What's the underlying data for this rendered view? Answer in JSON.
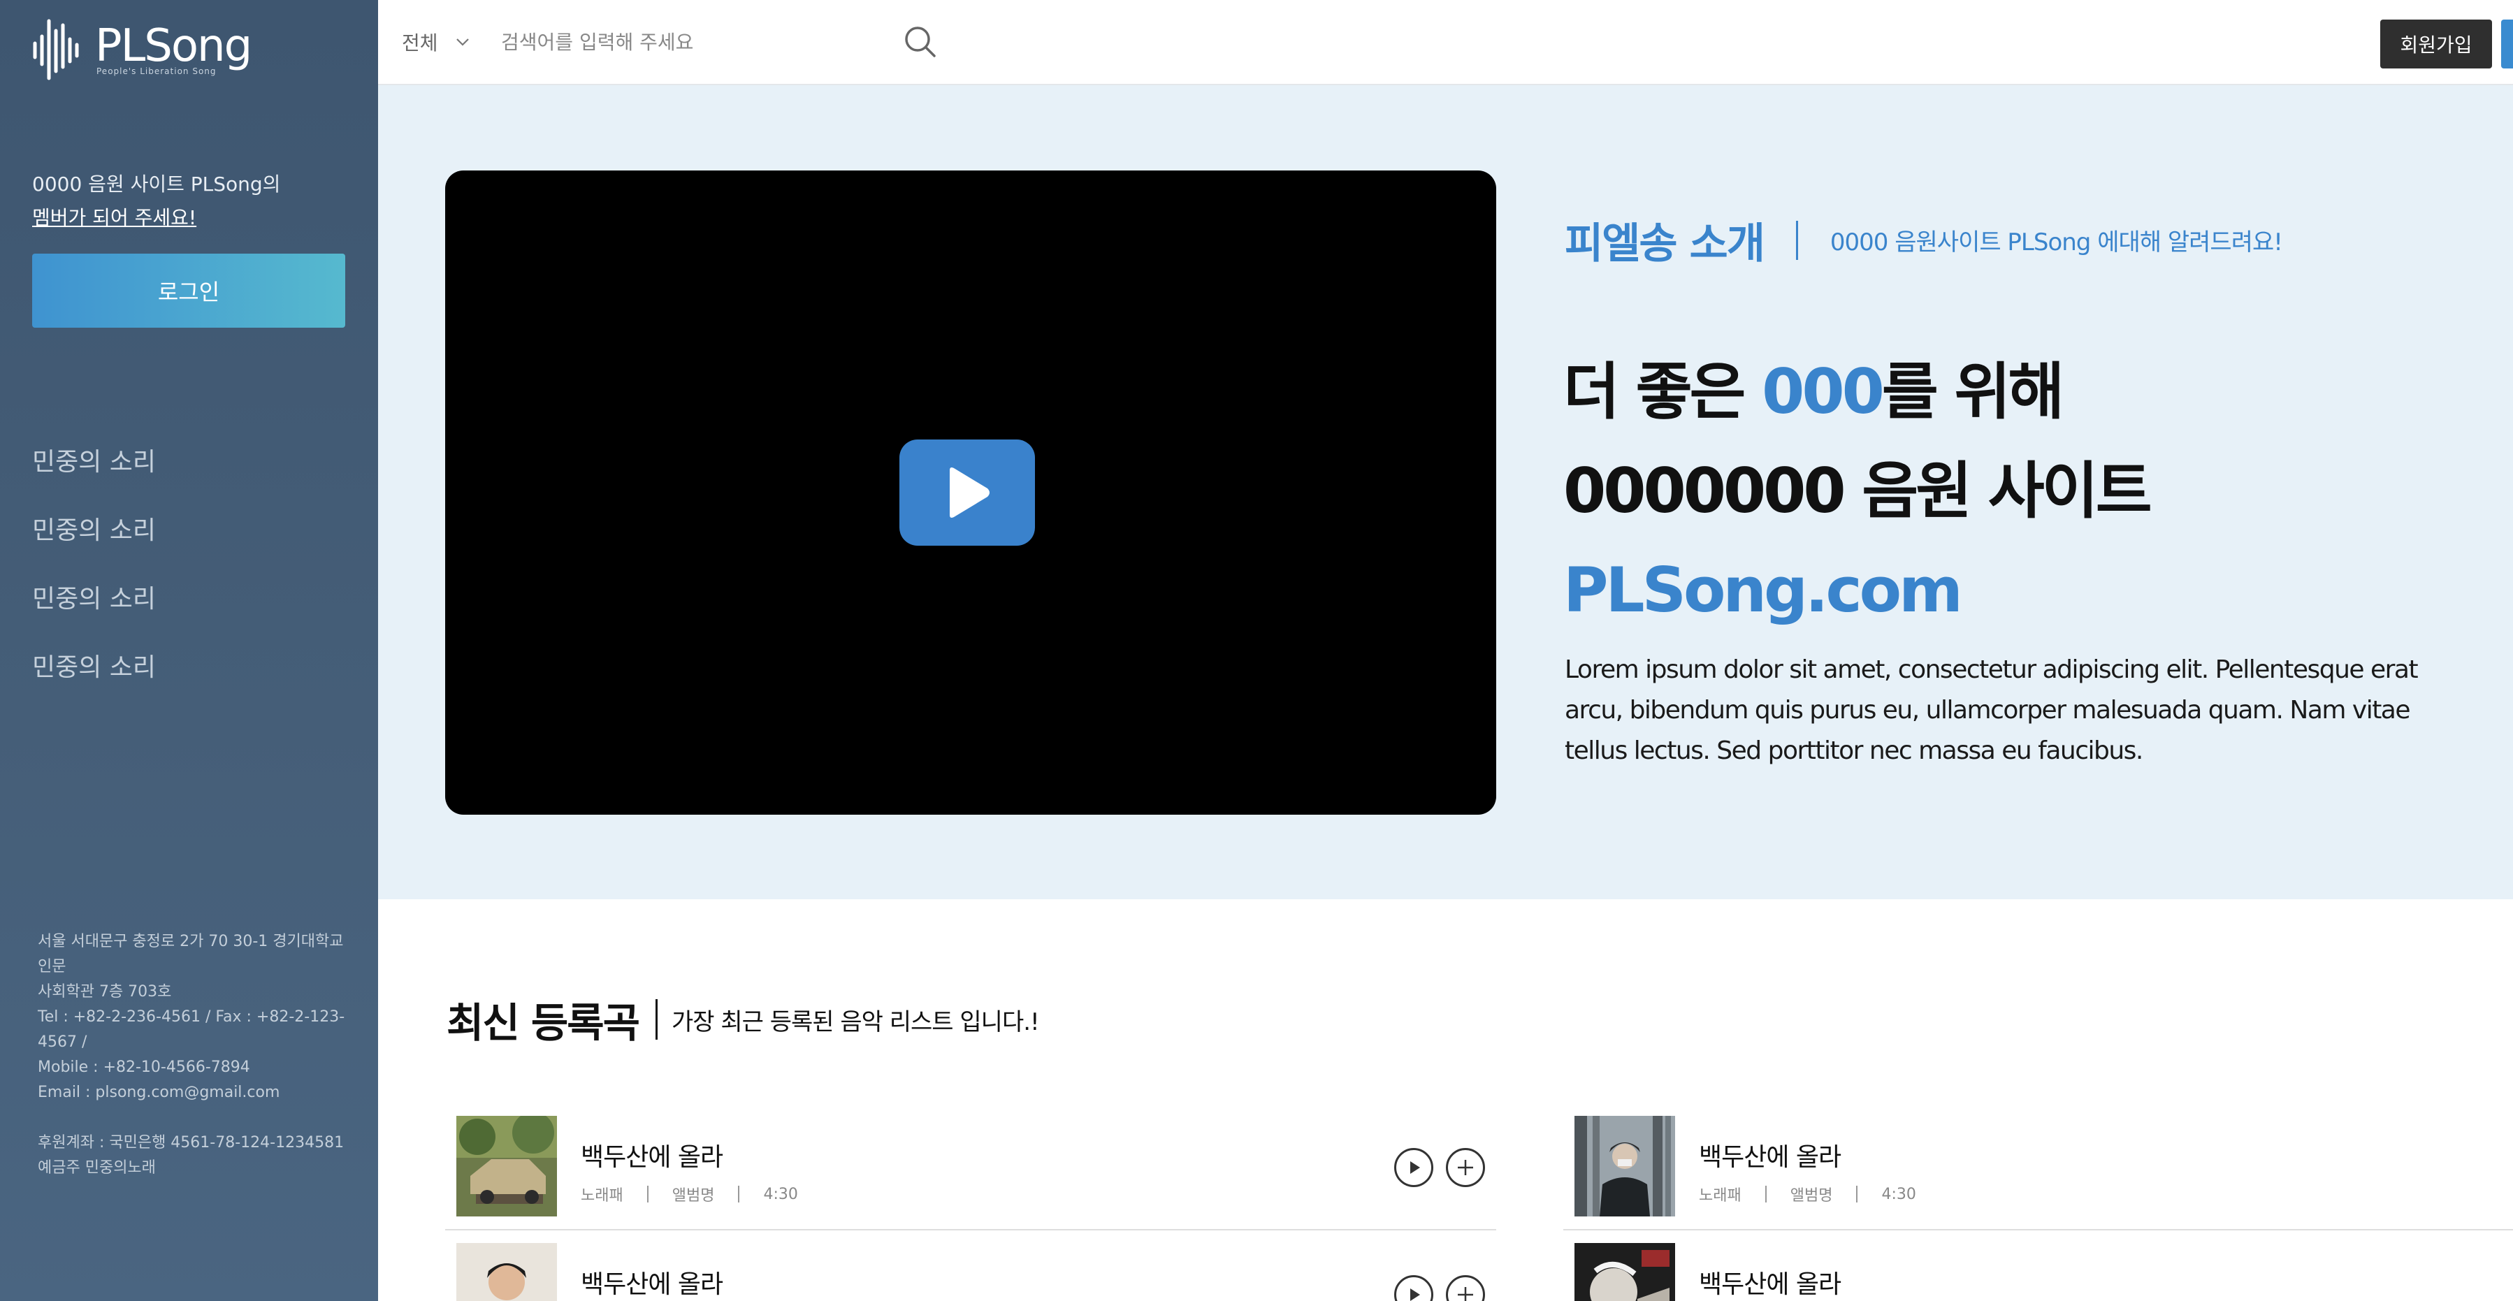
{
  "brand": {
    "name": "PLSong",
    "tagline": "People's Liberation Song"
  },
  "sidebar": {
    "promo_line1": "0000 음원 사이트 PLSong의",
    "promo_line2": "멤버가 되어 주세요!",
    "login_label": "로그인",
    "nav": [
      "민중의 소리",
      "민중의 소리",
      "민중의 소리",
      "민중의 소리"
    ],
    "footer": {
      "address1": "서울 서대문구 충정로 2가 70 30-1 경기대학교 인문",
      "address2": "사회학관 7층 703호",
      "tel_fax": "Tel : +82-2-236-4561 / Fax : +82-2-123-4567 /",
      "mobile": "Mobile : +82-10-4566-7894",
      "email": "Email : plsong.com@gmail.com",
      "account": "후원계좌 : 국민은행 4561-78-124-1234581",
      "holder": "예금주 민중의노래"
    }
  },
  "header": {
    "category": "전체",
    "search_placeholder": "검색어를 입력해 주세요",
    "signup_label": "회원가입"
  },
  "hero": {
    "intro_title": "피엘송 소개",
    "intro_sub": "0000 음원사이트 PLSong 에대해 알려드려요!",
    "headline_pre": "더 좋은 ",
    "headline_accent": "000",
    "headline_post": "를 위해",
    "headline_line2": "0000000 음원 사이트",
    "headline_line3": "PLSong.com",
    "description": "Lorem ipsum dolor sit amet, consectetur adipiscing elit. Pellentesque erat arcu, bibendum quis purus eu, ullamcorper malesuada quam. Nam vitae tellus lectus. Sed porttitor nec massa eu faucibus."
  },
  "latest": {
    "title": "최신 등록곡",
    "subtitle": "가장 최근 등록된 음악 리스트 입니다.!",
    "tracks": [
      {
        "title": "백두산에 올라",
        "artist": "노래패",
        "album": "앨범명",
        "duration": "4:30"
      },
      {
        "title": "백두산에 올라",
        "artist": "노래패",
        "album": "앨범명",
        "duration": "4:30"
      },
      {
        "title": "백두산에 올라"
      },
      {
        "title": "백두산에 올라"
      }
    ]
  },
  "colors": {
    "accent": "#3a84cc",
    "sidebar": "#435b75",
    "hero_bg": "#e7f1f8"
  }
}
